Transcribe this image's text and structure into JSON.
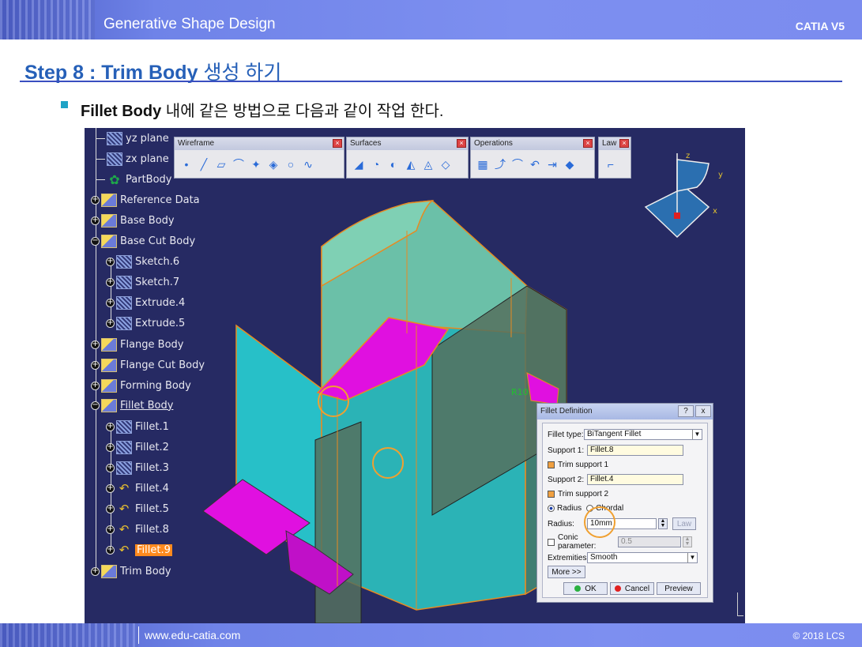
{
  "header": {
    "title": "Generative Shape Design",
    "product": "CATIA V5"
  },
  "step": {
    "title_en": "Step 8 : Trim Body",
    "title_ko": "생성 하기"
  },
  "bullet": {
    "bold": "Fillet Body",
    "rest": " 내에 같은 방법으로 다음과 같이 작업 한다."
  },
  "tree": {
    "items": [
      {
        "label": "yz plane",
        "icon": "plane-icon"
      },
      {
        "label": "zx plane",
        "icon": "plane-icon"
      },
      {
        "label": "PartBody",
        "icon": "gear-icon"
      },
      {
        "label": "Reference Data",
        "icon": "body-icon"
      },
      {
        "label": "Base Body",
        "icon": "body-icon"
      },
      {
        "label": "Base Cut Body",
        "icon": "body-icon"
      },
      {
        "label": "Sketch.6",
        "icon": "sketch-icon"
      },
      {
        "label": "Sketch.7",
        "icon": "sketch-icon"
      },
      {
        "label": "Extrude.4",
        "icon": "extrude-icon"
      },
      {
        "label": "Extrude.5",
        "icon": "extrude-icon"
      },
      {
        "label": "Flange Body",
        "icon": "body-icon"
      },
      {
        "label": "Flange Cut Body",
        "icon": "body-icon"
      },
      {
        "label": "Forming Body",
        "icon": "body-icon"
      },
      {
        "label": "Fillet Body",
        "icon": "body-icon"
      },
      {
        "label": "Fillet.1",
        "icon": "surface-icon"
      },
      {
        "label": "Fillet.2",
        "icon": "surface-icon"
      },
      {
        "label": "Fillet.3",
        "icon": "surface-icon"
      },
      {
        "label": "Fillet.4",
        "icon": "fillet-icon"
      },
      {
        "label": "Fillet.5",
        "icon": "fillet-icon"
      },
      {
        "label": "Fillet.8",
        "icon": "fillet-icon"
      },
      {
        "label": "Fillet.9",
        "icon": "fillet-icon"
      },
      {
        "label": "Trim Body",
        "icon": "body-icon"
      }
    ]
  },
  "toolbars": {
    "wireframe": "Wireframe",
    "surfaces": "Surfaces",
    "operations": "Operations",
    "law": "Law"
  },
  "axes": {
    "z": "z",
    "y": "y",
    "x": "x"
  },
  "dialog": {
    "title": "Fillet Definition",
    "help": "?",
    "close": "x",
    "fillet_type_label": "Fillet type:",
    "fillet_type_value": "BiTangent Fillet",
    "support1_label": "Support 1:",
    "support1_value": "Fillet.8",
    "trim1": "Trim support 1",
    "support2_label": "Support 2:",
    "support2_value": "Fillet.4",
    "trim2": "Trim support 2",
    "radius_option": "Radius",
    "chordal_option": "Chordal",
    "radius_label": "Radius:",
    "radius_value": "10mm",
    "law_button": "Law",
    "conic_label": "Conic parameter:",
    "conic_value": "0.5",
    "extremities_label": "Extremities:",
    "extremities_value": "Smooth",
    "more_button": "More >>",
    "ok_button": "OK",
    "cancel_button": "Cancel",
    "preview_button": "Preview"
  },
  "annotation": "R10",
  "footer": {
    "url": "www.edu-catia.com",
    "copyright": "© 2018 LCS"
  }
}
